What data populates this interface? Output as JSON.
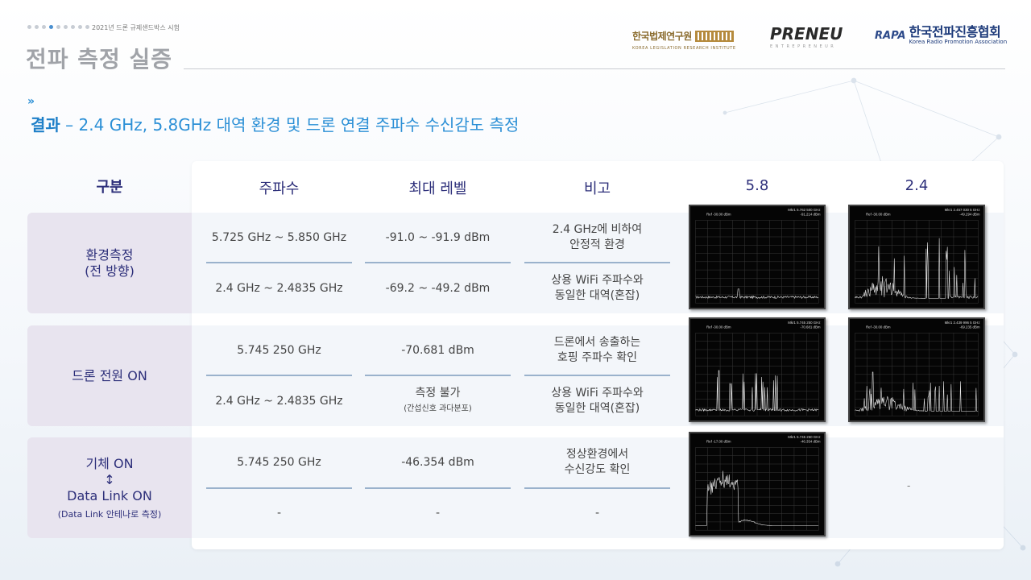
{
  "header": {
    "top_caption": "2021년 드론 규제샌드박스 시험",
    "page_title": "전파 측정 실증",
    "logos": {
      "klri_ko": "한국법제연구원",
      "klri_en": "KOREA LEGISLATION RESEARCH INSTITUTE",
      "preneu": "PRENEU",
      "preneu_sub": "ENTREPRENEUR",
      "rapa_mark": "RAPA",
      "rapa_ko": "한국전파진흥협회",
      "rapa_en": "Korea Radio Promotion Association"
    }
  },
  "section": {
    "strong": "결과",
    "rest": " – 2.4 GHz, 5.8GHz 대역 환경 및 드론 연결 주파수 수신감도 측정"
  },
  "table": {
    "headers": {
      "gubun": "구분",
      "freq": "주파수",
      "level": "최대 레벨",
      "note": "비고",
      "img58": "5.8",
      "img24": "2.4"
    },
    "groups": [
      {
        "title": "환경측정",
        "title2": "(전 방향)"
      },
      {
        "title": "드론 전원 ON"
      },
      {
        "title": "기체 ON",
        "arrow": "↕",
        "title2": "Data Link ON",
        "sub": "(Data Link 안테나로 측정)"
      }
    ],
    "rows": [
      {
        "freq": "5.725 GHz ~ 5.850 GHz",
        "level": "-91.0 ~ -91.9 dBm",
        "note1": "2.4 GHz에 비하여",
        "note2": "안정적 환경"
      },
      {
        "freq": "2.4 GHz ~ 2.4835 GHz",
        "level": "-69.2 ~ -49.2 dBm",
        "note1": "상용 WiFi 주파수와",
        "note2": "동일한 대역(혼잡)"
      },
      {
        "freq": "5.745 250 GHz",
        "level": "-70.681 dBm",
        "note1": "드론에서 송출하는",
        "note2": "호핑 주파수 확인"
      },
      {
        "freq": "2.4 GHz ~ 2.4835 GHz",
        "level": "측정 불가",
        "level_sub": "(간섭신호 과다분포)",
        "note1": "상용 WiFi 주파수와",
        "note2": "동일한 대역(혼잡)"
      },
      {
        "freq": "5.745 250 GHz",
        "level": "-46.354 dBm",
        "note1": "정상환경에서",
        "note2": "수신강도 확인"
      },
      {
        "freq": "-",
        "level": "-",
        "note1": "-",
        "note2": ""
      }
    ],
    "empty_cell": "-"
  },
  "spectra": [
    {
      "marker": "Mkr1 5.762 500 GHz",
      "marker_val": "-91.214 dBm",
      "ref": "Ref -30.00 dBm"
    },
    {
      "marker": "Mkr1 2.457 030 5 GHz",
      "marker_val": "-49.294 dBm",
      "ref": "Ref -30.00 dBm"
    },
    {
      "marker": "Mkr1 5.745 250 GHz",
      "marker_val": "-70.681 dBm",
      "ref": "Ref -30.00 dBm"
    },
    {
      "marker": "Mkr1 2.439 996 5 GHz",
      "marker_val": "-69.235 dBm",
      "ref": "Ref -30.00 dBm"
    },
    {
      "marker": "Mkr1 5.745 250 GHz",
      "marker_val": "-46.354 dBm",
      "ref": "Ref -17.00 dBm"
    }
  ],
  "colors": {
    "accent": "#2b8fd6",
    "header_text": "#2d2f7a",
    "group_bg": "#e8e4ef"
  }
}
